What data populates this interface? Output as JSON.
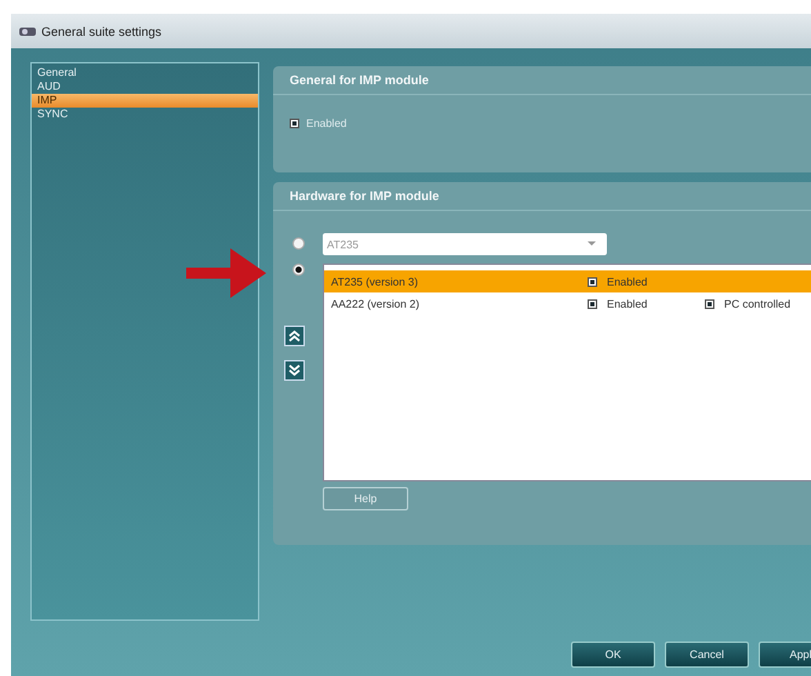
{
  "window": {
    "title": "General suite settings"
  },
  "sidebar": {
    "items": [
      {
        "label": "General",
        "selected": false
      },
      {
        "label": "AUD",
        "selected": false
      },
      {
        "label": "IMP",
        "selected": true
      },
      {
        "label": "SYNC",
        "selected": false
      }
    ]
  },
  "general_panel": {
    "title": "General for IMP module",
    "enabled": {
      "label": "Enabled",
      "checked": true
    }
  },
  "hardware_panel": {
    "title": "Hardware for IMP module",
    "dropdown": {
      "value": "AT235",
      "selected": false
    },
    "list": {
      "selected": true,
      "rows": [
        {
          "name": "AT235 (version 3)",
          "selected": true,
          "options": [
            {
              "label": "Enabled",
              "checked": true
            }
          ]
        },
        {
          "name": "AA222 (version 2)",
          "selected": false,
          "options": [
            {
              "label": "Enabled",
              "checked": true
            },
            {
              "label": "PC controlled",
              "checked": true
            }
          ]
        }
      ]
    },
    "help_button": "Help"
  },
  "buttons": [
    "OK",
    "Cancel",
    "Appl"
  ]
}
